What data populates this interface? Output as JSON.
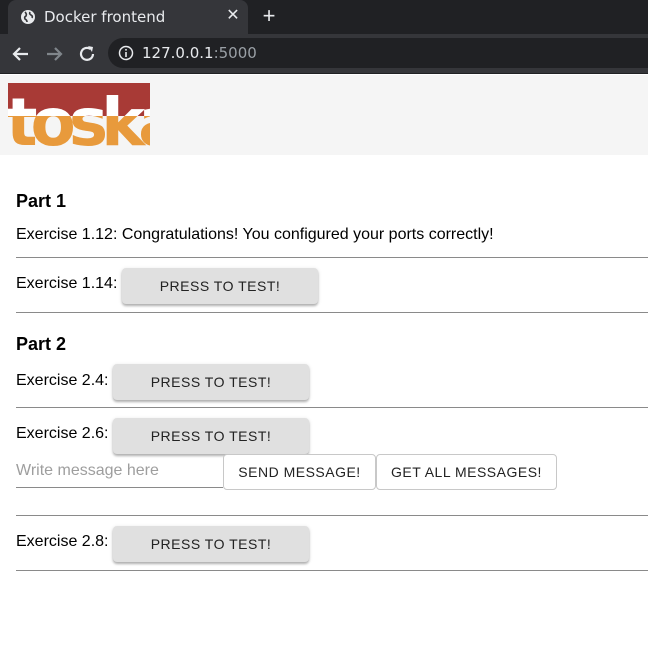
{
  "browser": {
    "tab_title": "Docker frontend",
    "url_host": "127.0.0.1",
    "url_port": ":5000"
  },
  "header": {
    "logo_text": "toska",
    "logo_colors": {
      "top": "#a83a36",
      "bottom": "#e89a3c"
    }
  },
  "part1": {
    "title": "Part 1",
    "exercise_1_12": "Exercise 1.12: Congratulations! You configured your ports correctly!",
    "exercise_1_14_label": "Exercise 1.14:",
    "exercise_1_14_button": "PRESS TO TEST!"
  },
  "part2": {
    "title": "Part 2",
    "exercise_2_4_label": "Exercise 2.4:",
    "exercise_2_4_button": "PRESS TO TEST!",
    "exercise_2_6_label": "Exercise 2.6:",
    "exercise_2_6_button": "PRESS TO TEST!",
    "message_placeholder": "Write message here",
    "send_message_button": "SEND MESSAGE!",
    "get_all_messages_button": "GET ALL MESSAGES!",
    "exercise_2_8_label": "Exercise 2.8:",
    "exercise_2_8_button": "PRESS TO TEST!"
  }
}
